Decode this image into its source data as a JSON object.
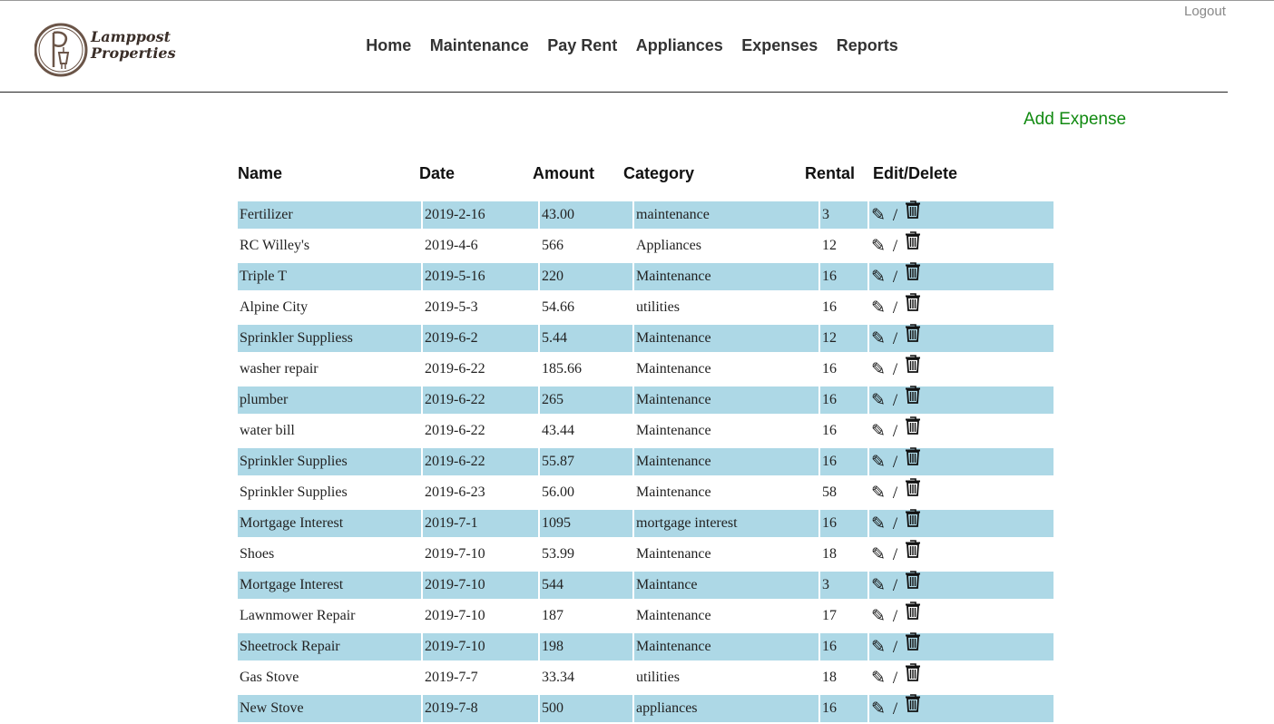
{
  "header": {
    "logout_label": "Logout",
    "logo_line1": "Lamppost",
    "logo_line2": "Properties",
    "nav": [
      "Home",
      "Maintenance",
      "Pay Rent",
      "Appliances",
      "Expenses",
      "Reports"
    ]
  },
  "main": {
    "add_expense_label": "Add Expense",
    "columns": [
      "Name",
      "Date",
      "Amount",
      "Category",
      "Rental",
      "Edit/Delete"
    ],
    "separator": "/",
    "rows": [
      {
        "name": "Fertilizer",
        "date": "2019-2-16",
        "amount": "43.00",
        "category": "maintenance",
        "rental": "3"
      },
      {
        "name": "RC Willey's",
        "date": "2019-4-6",
        "amount": "566",
        "category": "Appliances",
        "rental": "12"
      },
      {
        "name": "Triple T",
        "date": "2019-5-16",
        "amount": "220",
        "category": "Maintenance",
        "rental": "16"
      },
      {
        "name": "Alpine City",
        "date": "2019-5-3",
        "amount": "54.66",
        "category": "utilities",
        "rental": "16"
      },
      {
        "name": "Sprinkler Suppliess",
        "date": "2019-6-2",
        "amount": "5.44",
        "category": "Maintenance",
        "rental": "12"
      },
      {
        "name": "washer repair",
        "date": "2019-6-22",
        "amount": "185.66",
        "category": "Maintenance",
        "rental": "16"
      },
      {
        "name": "plumber",
        "date": "2019-6-22",
        "amount": "265",
        "category": "Maintenance",
        "rental": "16"
      },
      {
        "name": "water bill",
        "date": "2019-6-22",
        "amount": "43.44",
        "category": "Maintenance",
        "rental": "16"
      },
      {
        "name": "Sprinkler Supplies",
        "date": "2019-6-22",
        "amount": "55.87",
        "category": "Maintenance",
        "rental": "16"
      },
      {
        "name": "Sprinkler Supplies",
        "date": "2019-6-23",
        "amount": "56.00",
        "category": "Maintenance",
        "rental": "58"
      },
      {
        "name": "Mortgage Interest",
        "date": "2019-7-1",
        "amount": "1095",
        "category": "mortgage interest",
        "rental": "16"
      },
      {
        "name": "Shoes",
        "date": "2019-7-10",
        "amount": "53.99",
        "category": "Maintenance",
        "rental": "18"
      },
      {
        "name": "Mortgage Interest",
        "date": "2019-7-10",
        "amount": "544",
        "category": "Maintance",
        "rental": "3"
      },
      {
        "name": "Lawnmower Repair",
        "date": "2019-7-10",
        "amount": "187",
        "category": "Maintenance",
        "rental": "17"
      },
      {
        "name": "Sheetrock Repair",
        "date": "2019-7-10",
        "amount": "198",
        "category": "Maintenance",
        "rental": "16"
      },
      {
        "name": "Gas Stove",
        "date": "2019-7-7",
        "amount": "33.34",
        "category": "utilities",
        "rental": "18"
      },
      {
        "name": "New Stove",
        "date": "2019-7-8",
        "amount": "500",
        "category": "appliances",
        "rental": "16"
      }
    ]
  },
  "colors": {
    "row_shade": "#add8e6",
    "add_expense": "#118a11",
    "logo_brown": "#6b5548"
  },
  "icons": {
    "edit": "pencil-icon",
    "delete": "trash-icon"
  }
}
